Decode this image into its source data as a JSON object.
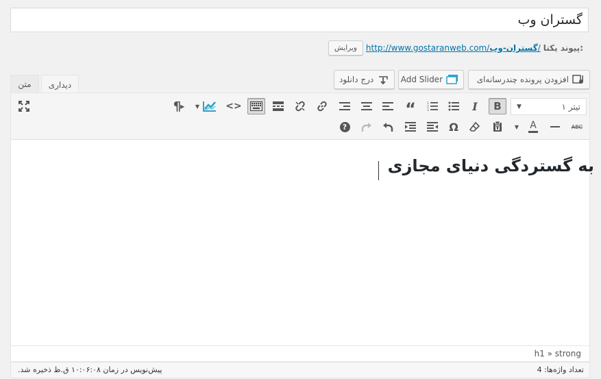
{
  "post_title": "گستران وب",
  "permalink": {
    "label": "پیوند یکتا:",
    "base_url": "http://www.gostaranweb.com",
    "slug": "گستران-وب",
    "trailing": "/",
    "edit_label": "ویرایش"
  },
  "media_buttons": {
    "add_gallery": "افزودن پرونده چندرسانه‌ای",
    "add_slider": "Add Slider",
    "insert_download": "درج دانلود"
  },
  "tabs": {
    "visual": "دیداری",
    "text": "متن"
  },
  "toolbar": {
    "format_select": "تیتر ۱",
    "bold": "B",
    "italic": "I",
    "text_color": "A",
    "special_char": "Ω",
    "help": "?",
    "strike": "ABC"
  },
  "content": {
    "heading": "به گستردگی دنیای مجازی"
  },
  "path": "h1 » strong",
  "status": {
    "word_count": "تعداد واژه‌ها: 4",
    "autosave": "پیش‌نویس در زمان ۱۰:۰۶:۰۸ ق.ظ ذخیره شد."
  },
  "colors": {
    "link": "#0073aa",
    "icon": "#555555",
    "accent_teal": "#2ea2cc"
  }
}
